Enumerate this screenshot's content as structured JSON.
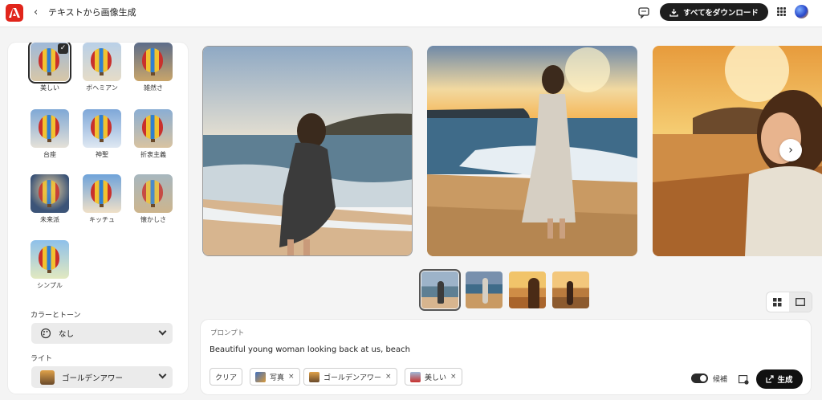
{
  "header": {
    "title": "テキストから画像生成",
    "back_glyph": "‹",
    "download_label": "すべてをダウンロード"
  },
  "styles": [
    {
      "label": "美しい",
      "selected": true
    },
    {
      "label": "ボヘミアン",
      "selected": false
    },
    {
      "label": "雑然さ",
      "selected": false
    },
    {
      "label": "台座",
      "selected": false
    },
    {
      "label": "神聖",
      "selected": false
    },
    {
      "label": "折衷主義",
      "selected": false
    },
    {
      "label": "未来派",
      "selected": false
    },
    {
      "label": "キッチュ",
      "selected": false
    },
    {
      "label": "懐かしさ",
      "selected": false
    },
    {
      "label": "シンプル",
      "selected": false
    }
  ],
  "color_tone": {
    "label": "カラーとトーン",
    "value": "なし"
  },
  "light": {
    "label": "ライト",
    "value": "ゴールデンアワー"
  },
  "prompt": {
    "label": "プロンプト",
    "text": "Beautiful young woman looking back at us, beach",
    "clear_label": "クリア",
    "chips": [
      "写真",
      "ゴールデンアワー",
      "美しい"
    ],
    "toggle_label": "候補",
    "generate_label": "生成"
  },
  "view_toggle": {
    "selected": "single"
  },
  "colors": {
    "brand": "#e1251b",
    "dark_button": "#1e1e1e"
  }
}
